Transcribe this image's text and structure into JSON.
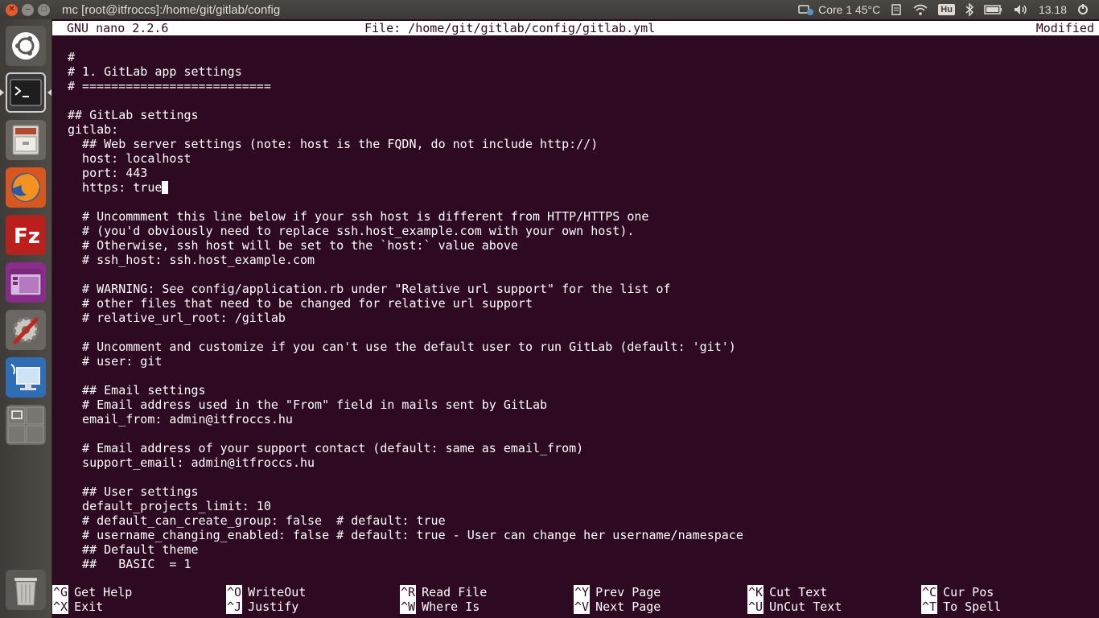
{
  "window": {
    "title": "mc [root@itfroccs]:/home/git/gitlab/config"
  },
  "panel": {
    "cpu_label": "Core 1 45°C",
    "keyboard": "Hu",
    "clock": "13.18"
  },
  "launcher": {
    "items": [
      "ubuntu-dash",
      "terminal",
      "file-manager",
      "firefox",
      "filezilla",
      "app-launcher",
      "system-settings",
      "remote-desktop",
      "workspace-switcher",
      "trash"
    ]
  },
  "nano": {
    "version": "GNU nano 2.2.6",
    "file": "File: /home/git/gitlab/config/gitlab.yml",
    "status": "Modified",
    "lines_before_cursor": "#\n# 1. GitLab app settings\n# ==========================\n\n## GitLab settings\ngitlab:\n  ## Web server settings (note: host is the FQDN, do not include http://)\n  host: localhost\n  port: 443\n  https: true",
    "lines_after_cursor": "\n\n  # Uncommment this line below if your ssh host is different from HTTP/HTTPS one\n  # (you'd obviously need to replace ssh.host_example.com with your own host).\n  # Otherwise, ssh host will be set to the `host:` value above\n  # ssh_host: ssh.host_example.com\n\n  # WARNING: See config/application.rb under \"Relative url support\" for the list of\n  # other files that need to be changed for relative url support\n  # relative_url_root: /gitlab\n\n  # Uncomment and customize if you can't use the default user to run GitLab (default: 'git')\n  # user: git\n\n  ## Email settings\n  # Email address used in the \"From\" field in mails sent by GitLab\n  email_from: admin@itfroccs.hu\n\n  # Email address of your support contact (default: same as email_from)\n  support_email: admin@itfroccs.hu\n\n  ## User settings\n  default_projects_limit: 10\n  # default_can_create_group: false  # default: true\n  # username_changing_enabled: false # default: true - User can change her username/namespace\n  ## Default theme\n  ##   BASIC  = 1",
    "shortcuts": [
      {
        "key": "^G",
        "label": "Get Help"
      },
      {
        "key": "^O",
        "label": "WriteOut"
      },
      {
        "key": "^R",
        "label": "Read File"
      },
      {
        "key": "^Y",
        "label": "Prev Page"
      },
      {
        "key": "^K",
        "label": "Cut Text"
      },
      {
        "key": "^C",
        "label": "Cur Pos"
      },
      {
        "key": "^X",
        "label": "Exit"
      },
      {
        "key": "^J",
        "label": "Justify"
      },
      {
        "key": "^W",
        "label": "Where Is"
      },
      {
        "key": "^V",
        "label": "Next Page"
      },
      {
        "key": "^U",
        "label": "UnCut Text"
      },
      {
        "key": "^T",
        "label": "To Spell"
      }
    ]
  },
  "colors": {
    "terminal_bg": "#2d0922",
    "terminal_fg": "#ffffff",
    "panel_bg": "#3b3a36",
    "close_button": "#e85a2d"
  }
}
